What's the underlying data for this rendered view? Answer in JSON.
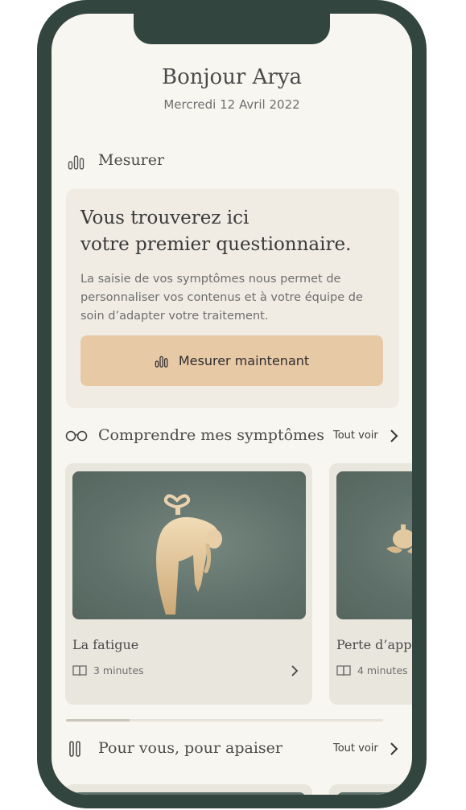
{
  "header": {
    "greeting": "Bonjour Arya",
    "date": "Mercredi 12 Avril 2022"
  },
  "measure": {
    "section_title": "Mesurer",
    "icon": "bar-chart-icon",
    "card_title_line1": "Vous trouverez ici",
    "card_title_line2": "votre premier questionnaire.",
    "card_text": "La saisie de vos symptômes nous permet de personnaliser vos contenus et à votre équipe de soin d’adapter votre traitement.",
    "cta_label": "Mesurer maintenant"
  },
  "symptoms": {
    "section_title": "Comprendre mes symptômes",
    "icon": "glasses-icon",
    "see_all": "Tout voir",
    "articles": [
      {
        "title": "La fatigue",
        "duration": "3 minutes",
        "icon": "book-icon"
      },
      {
        "title": "Perte d’appe",
        "duration": "4 minutes",
        "icon": "book-icon"
      }
    ]
  },
  "soothe": {
    "section_title": "Pour vous, pour apaiser",
    "icon": "pause-icon",
    "see_all": "Tout voir"
  },
  "carousel": {
    "scroll_progress": 0.2
  },
  "colors": {
    "frame": "#33453f",
    "background": "#f8f6f1",
    "cta": "#e8c9a6",
    "card": "#f0ece4",
    "illustration_bg": "#5f706a",
    "illustration_fg": "#e3c9a0"
  }
}
